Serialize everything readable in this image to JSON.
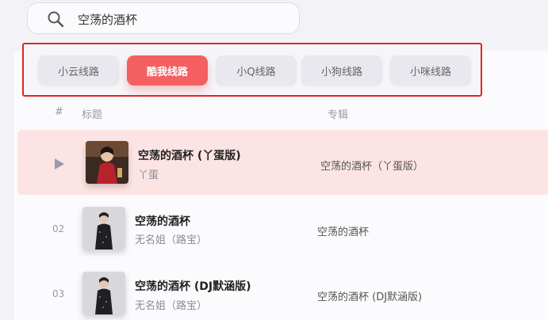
{
  "search": {
    "query": "空荡的酒杯"
  },
  "tabs": [
    {
      "label": "小云线路",
      "active": false
    },
    {
      "label": "酷我线路",
      "active": true
    },
    {
      "label": "小Q线路",
      "active": false
    },
    {
      "label": "小狗线路",
      "active": false
    },
    {
      "label": "小咪线路",
      "active": false
    }
  ],
  "columns": {
    "index": "#",
    "title": "标题",
    "album": "专辑"
  },
  "songs": [
    {
      "num": "",
      "title": "空荡的酒杯 (丫蛋版)",
      "artist": "丫蛋",
      "album": "空荡的酒杯（丫蛋版）",
      "playing": true
    },
    {
      "num": "02",
      "title": "空荡的酒杯",
      "artist": "无名姐（路宝）",
      "album": "空荡的酒杯",
      "playing": false
    },
    {
      "num": "03",
      "title": "空荡的酒杯 (DJ默涵版)",
      "artist": "无名姐（路宝）",
      "album": "空荡的酒杯 (DJ默涵版)",
      "playing": false
    }
  ],
  "colors": {
    "accent": "#f45f62",
    "highlight_row": "#fde4e4",
    "annotation_border": "#e3231d"
  }
}
